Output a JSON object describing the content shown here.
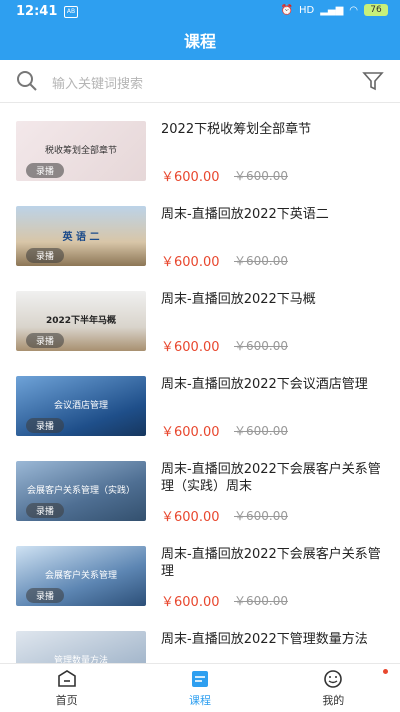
{
  "status": {
    "time": "12:41",
    "battery": "76"
  },
  "header": {
    "title": "课程"
  },
  "search": {
    "placeholder": "输入关键词搜索"
  },
  "courses": [
    {
      "title": "2022下税收筹划全部章节",
      "price": "￥600.00",
      "original_price": "￥600.00",
      "tag": "录播",
      "thumb_caption": "税收筹划全部章节"
    },
    {
      "title": "周末-直播回放2022下英语二",
      "price": "￥600.00",
      "original_price": "￥600.00",
      "tag": "录播",
      "thumb_caption": "英 语 二"
    },
    {
      "title": "周末-直播回放2022下马概",
      "price": "￥600.00",
      "original_price": "￥600.00",
      "tag": "录播",
      "thumb_caption": "2022下半年马概"
    },
    {
      "title": "周末-直播回放2022下会议酒店管理",
      "price": "￥600.00",
      "original_price": "￥600.00",
      "tag": "录播",
      "thumb_caption": "会议酒店管理"
    },
    {
      "title": "周末-直播回放2022下会展客户关系管理（实践）周末",
      "price": "￥600.00",
      "original_price": "￥600.00",
      "tag": "录播",
      "thumb_caption": "会展客户关系管理（实践）"
    },
    {
      "title": "周末-直播回放2022下会展客户关系管理",
      "price": "￥600.00",
      "original_price": "￥600.00",
      "tag": "录播",
      "thumb_caption": "会展客户关系管理"
    },
    {
      "title": " 周末-直播回放2022下管理数量方法",
      "price": "",
      "original_price": "",
      "tag": "",
      "thumb_caption": "管理数量方法"
    }
  ],
  "tabs": [
    {
      "label": "首页"
    },
    {
      "label": "课程"
    },
    {
      "label": "我的"
    }
  ],
  "colors": {
    "accent": "#2e9ff0",
    "price": "#e8472e"
  }
}
